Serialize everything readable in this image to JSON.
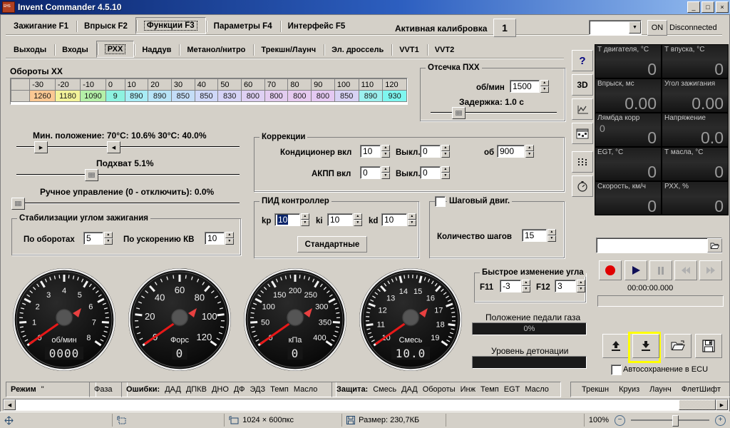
{
  "window": {
    "title": "Invent Commander 4.5.10",
    "minimize": "_",
    "maximize": "□",
    "close": "×"
  },
  "main_tabs": [
    {
      "label": "Зажигание F1",
      "selected": false
    },
    {
      "label": "Впрыск F2",
      "selected": false
    },
    {
      "label": "Функции F3",
      "selected": true
    },
    {
      "label": "Параметры F4",
      "selected": false
    },
    {
      "label": "Интерфейс F5",
      "selected": false
    }
  ],
  "sub_tabs": [
    {
      "label": "Выходы",
      "selected": false
    },
    {
      "label": "Входы",
      "selected": false
    },
    {
      "label": "РХХ",
      "selected": true
    },
    {
      "label": "Наддув",
      "selected": false
    },
    {
      "label": "Метанол/нитро",
      "selected": false
    },
    {
      "label": "Трекшн/Лаунч",
      "selected": false
    },
    {
      "label": "Эл. дроссель",
      "selected": false
    },
    {
      "label": "VVT1",
      "selected": false
    },
    {
      "label": "VVT2",
      "selected": false
    }
  ],
  "header": {
    "calibration_label": "Активная калибровка",
    "calibration_value": "1",
    "combo_value": "",
    "on_button": "ON",
    "connection_status": "Disconnected"
  },
  "idle_table": {
    "title": "Обороты ХХ",
    "headers": [
      "",
      "-30",
      "-20",
      "-10",
      "0",
      "10",
      "20",
      "30",
      "40",
      "50",
      "60",
      "70",
      "80",
      "90",
      "100",
      "110",
      "120"
    ],
    "values": [
      "",
      "1260",
      "1180",
      "1090",
      "9",
      "890",
      "890",
      "850",
      "850",
      "830",
      "800",
      "800",
      "800",
      "800",
      "850",
      "890",
      "930"
    ],
    "cell_colors": [
      "#d4d0c8",
      "#fbc893",
      "#f3f39a",
      "#b4f0a8",
      "#8df2e0",
      "#a8ecf5",
      "#b8e4f7",
      "#c4ddf7",
      "#cfd8f8",
      "#d6d3f6",
      "#ded0f3",
      "#e3ccf0",
      "#e6caef",
      "#e4c9f2",
      "#d7d2f4",
      "#9cf0ee",
      "#7ef6ef"
    ],
    "selected_index": 4
  },
  "cutoff": {
    "title": "Отсечка ПХХ",
    "rpm_label": "об/мин",
    "rpm_value": "1500",
    "delay_label": "Задержка: 1.0 с"
  },
  "sliders": {
    "min_position_label": "Мин. положение:   70°С: 10.6%    30°С: 40.0%",
    "pickup_label": "Подхват 5.1%",
    "manual_label": "Ручное управление (0 - отключить): 0.0%"
  },
  "stabilization": {
    "title": "Стабилизации углом зажигания",
    "rpm_label": "По оборотах",
    "rpm_value": "5",
    "accel_label": "По ускорению КВ",
    "accel_value": "10"
  },
  "corrections": {
    "title": "Коррекции",
    "ac_on_label": "Кондиционер вкл",
    "ac_on_value": "10",
    "ac_off_label": "Выкл.",
    "ac_off_value": "0",
    "rpm_label": "об",
    "rpm_value": "900",
    "at_on_label": "АКПП вкл",
    "at_on_value": "0",
    "at_off_label": "Выкл.",
    "at_off_value": "0"
  },
  "pid": {
    "title": "ПИД контроллер",
    "kp_label": "kp",
    "kp_value": "10",
    "ki_label": "ki",
    "ki_value": "10",
    "kd_label": "kd",
    "kd_value": "10",
    "default_button": "Стандартные"
  },
  "stepper": {
    "title": "Шаговый двиг.",
    "checked": false,
    "steps_label": "Количество шагов",
    "steps_value": "15"
  },
  "toolbar_icons": [
    {
      "name": "help-icon",
      "glyph": "?"
    },
    {
      "name": "3d-icon",
      "glyph": "3D"
    },
    {
      "name": "chart-icon",
      "glyph": ""
    },
    {
      "name": "window-icon",
      "glyph": ""
    },
    {
      "name": "dots-icon",
      "glyph": ""
    },
    {
      "name": "stopwatch-icon",
      "glyph": ""
    }
  ],
  "readouts": [
    {
      "caption": "Т двигателя, °C",
      "value": "0"
    },
    {
      "caption": "Т впуска, °C",
      "value": "0"
    },
    {
      "caption": "Впрыск, мс",
      "value": "0.00"
    },
    {
      "caption": "Угол зажигания",
      "value": "0.00"
    },
    {
      "caption": "Лямбда корр",
      "value": "0",
      "value2": "0"
    },
    {
      "caption": "Напряжение",
      "value": "0.0"
    },
    {
      "caption": "EGT, °C",
      "value": "0"
    },
    {
      "caption": "Т масла, °C",
      "value": "0"
    },
    {
      "caption": "Скорость, км/ч",
      "value": "0"
    },
    {
      "caption": "РХХ, %",
      "value": "0"
    }
  ],
  "gauges": [
    {
      "unit": "об/мин",
      "digital": "0000",
      "ticks": [
        "0",
        "1",
        "2",
        "3",
        "4",
        "5",
        "6",
        "7",
        "8"
      ],
      "value": 0,
      "max": 8
    },
    {
      "unit": "Форс",
      "digital": "0",
      "ticks": [
        "0",
        "20",
        "40",
        "60",
        "80",
        "100",
        "120"
      ],
      "value": 0,
      "max": 120
    },
    {
      "unit": "кПа",
      "digital": "0",
      "ticks": [
        "0",
        "50",
        "100",
        "150",
        "200",
        "250",
        "300",
        "350",
        "400"
      ],
      "value": 0,
      "max": 400
    },
    {
      "unit": "Смесь",
      "digital": "10.0",
      "ticks": [
        "10",
        "11",
        "12",
        "13",
        "14",
        "15",
        "16",
        "17",
        "18",
        "19"
      ],
      "value": 10,
      "max": 19
    }
  ],
  "quick_angle": {
    "title": "Быстрое изменение угла",
    "f11_label": "F11",
    "f11_value": "-3",
    "f12_label": "F12",
    "f12_value": "3"
  },
  "pedal": {
    "label": "Положение педали газа",
    "value": "0%"
  },
  "knock": {
    "label": "Уровень детонации",
    "value": ""
  },
  "recorder": {
    "path_value": "",
    "open_icon": "folder-open-icon",
    "record": "record-button",
    "play": "play-button",
    "pause": "pause-button",
    "rewind": "rewind-button",
    "forward": "forward-button",
    "time": "00:00:00.000"
  },
  "ecu_actions": {
    "upload": "upload-to-ecu-button",
    "download": "download-from-ecu-button",
    "open": "open-file-button",
    "save": "save-file-button",
    "autosave_label": "Автосохранение в ECU",
    "autosave_checked": false,
    "highlight_color": "#ffff00"
  },
  "status_panels": {
    "mode_label": "Режим",
    "mode_value": "\"",
    "phase_label": "Фаза",
    "errors_label": "Ошибки:",
    "errors": [
      "ДАД",
      "ДПКВ",
      "ДНО",
      "ДФ",
      "ЭДЗ",
      "Темп",
      "Масло"
    ],
    "protection_label": "Защита:",
    "protection": [
      "Смесь",
      "ДАД",
      "Обороты",
      "Инж",
      "Темп",
      "EGT",
      "Масло"
    ],
    "modes": [
      "Трекшн",
      "Круиз",
      "Лаунч",
      "ФлетШифт"
    ]
  },
  "statusbar": {
    "size_label": "Размер: 230,7КБ",
    "dimensions": "1024 × 600пкс",
    "zoom": "100%",
    "zoom_out": "−",
    "zoom_in": "+"
  }
}
